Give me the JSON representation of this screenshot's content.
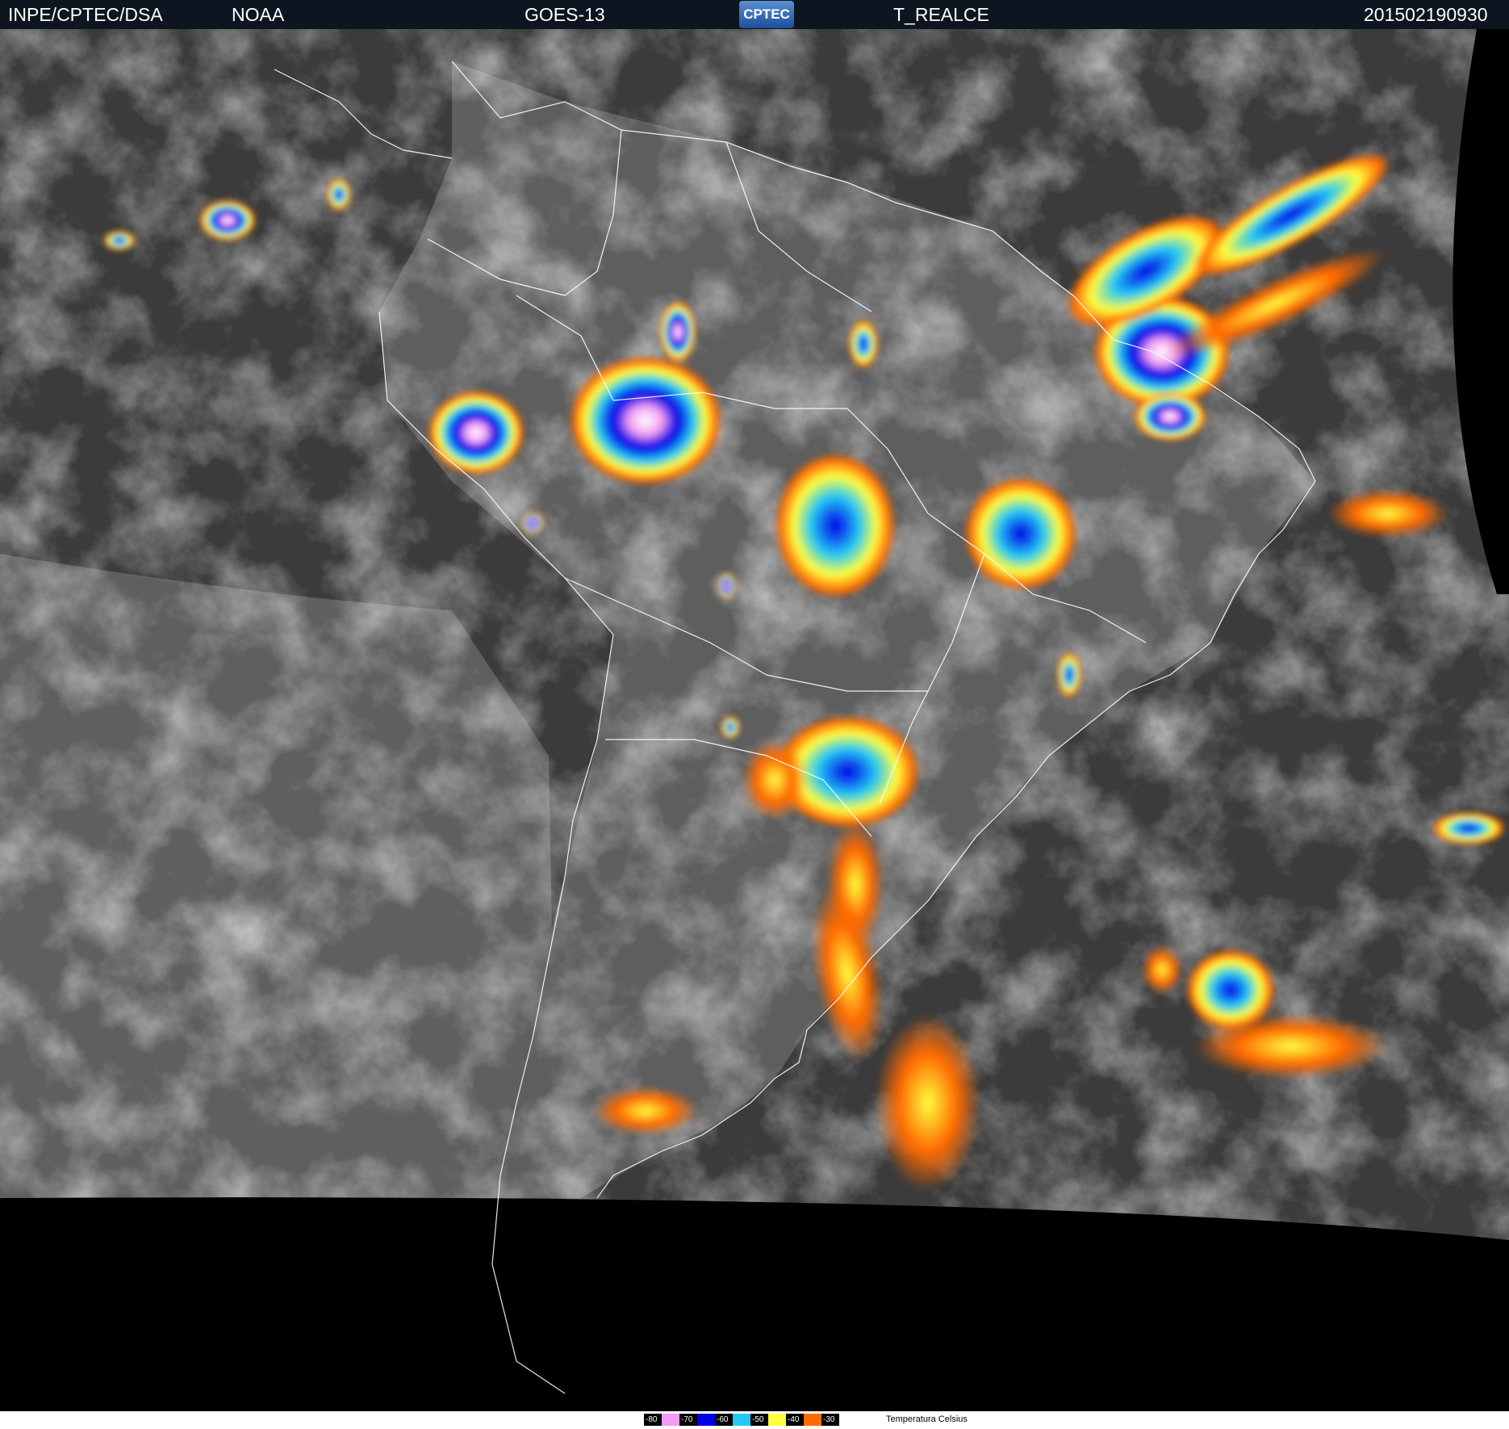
{
  "header": {
    "institution": "INPE/CPTEC/DSA",
    "agency": "NOAA",
    "satellite": "GOES-13",
    "logo_text": "CPTEC",
    "product": "T_REALCE",
    "datetime": "201502190930"
  },
  "legend": {
    "items": [
      {
        "label": "-80",
        "color": "#000000",
        "swatch": "#f29bf2"
      },
      {
        "label": "-70",
        "color": "#000000",
        "swatch": "#0000e6"
      },
      {
        "label": "-60",
        "color": "#000000",
        "swatch": "#23c8f5"
      },
      {
        "label": "-50",
        "color": "#000000",
        "swatch": "#ffff40"
      },
      {
        "label": "-40",
        "color": "#000000",
        "swatch": "#ff6a00"
      },
      {
        "label": "-30",
        "color": "#000000",
        "swatch": null
      }
    ],
    "caption": "Temperatura  Celsius"
  },
  "colors": {
    "pink": "#f29bf2",
    "blue": "#0000e6",
    "cyan": "#23c8f5",
    "yellow": "#ffff40",
    "orange": "#ff6a00",
    "space": "#000000",
    "ocean_dark": "#3a3a3a",
    "land_gray": "#6b6b6b"
  }
}
